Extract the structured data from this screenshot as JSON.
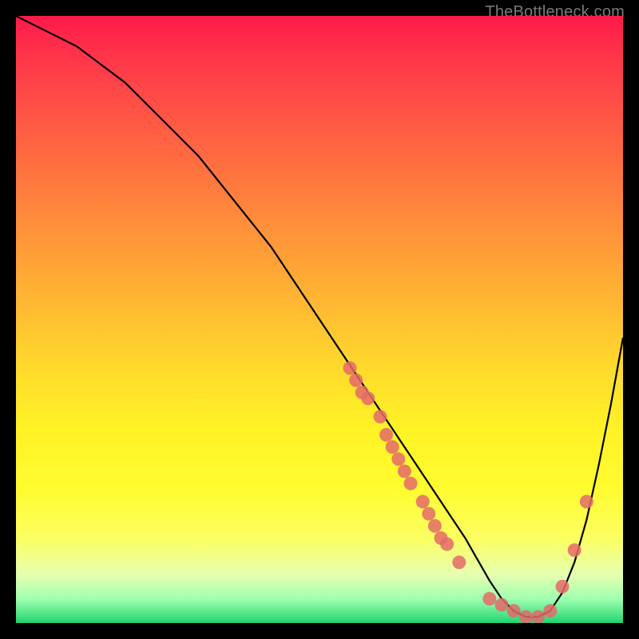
{
  "watermark": "TheBottleneck.com",
  "colors": {
    "curve": "#000000",
    "marker_fill": "#e46a6a",
    "marker_stroke": "#d85a5a",
    "background_black": "#000000"
  },
  "chart_data": {
    "type": "line",
    "title": "",
    "xlabel": "",
    "ylabel": "",
    "xlim": [
      0,
      100
    ],
    "ylim": [
      0,
      100
    ],
    "grid": false,
    "legend": false,
    "series": [
      {
        "name": "bottleneck-curve",
        "x": [
          0,
          2,
          4,
          6,
          8,
          10,
          14,
          18,
          22,
          26,
          30,
          34,
          38,
          42,
          46,
          50,
          54,
          58,
          62,
          66,
          70,
          74,
          78,
          80,
          82,
          84,
          86,
          88,
          90,
          92,
          94,
          96,
          98,
          100
        ],
        "y": [
          100,
          99,
          98,
          97,
          96,
          95,
          92,
          89,
          85,
          81,
          77,
          72,
          67,
          62,
          56,
          50,
          44,
          38,
          32,
          26,
          20,
          14,
          7,
          4,
          2,
          1,
          1,
          2,
          5,
          10,
          17,
          26,
          36,
          47
        ]
      }
    ],
    "markers": [
      {
        "name": "cluster-a",
        "points": [
          {
            "x": 55,
            "y": 42
          },
          {
            "x": 56,
            "y": 40
          },
          {
            "x": 57,
            "y": 38
          },
          {
            "x": 58,
            "y": 37
          },
          {
            "x": 60,
            "y": 34
          },
          {
            "x": 61,
            "y": 31
          },
          {
            "x": 62,
            "y": 29
          },
          {
            "x": 63,
            "y": 27
          },
          {
            "x": 64,
            "y": 25
          },
          {
            "x": 65,
            "y": 23
          },
          {
            "x": 67,
            "y": 20
          },
          {
            "x": 68,
            "y": 18
          },
          {
            "x": 69,
            "y": 16
          },
          {
            "x": 70,
            "y": 14
          },
          {
            "x": 71,
            "y": 13
          },
          {
            "x": 73,
            "y": 10
          }
        ]
      },
      {
        "name": "cluster-b",
        "points": [
          {
            "x": 78,
            "y": 4
          },
          {
            "x": 80,
            "y": 3
          },
          {
            "x": 82,
            "y": 2
          },
          {
            "x": 84,
            "y": 1
          },
          {
            "x": 86,
            "y": 1
          },
          {
            "x": 88,
            "y": 2
          }
        ]
      },
      {
        "name": "cluster-c",
        "points": [
          {
            "x": 90,
            "y": 6
          },
          {
            "x": 92,
            "y": 12
          },
          {
            "x": 94,
            "y": 20
          }
        ]
      }
    ]
  }
}
